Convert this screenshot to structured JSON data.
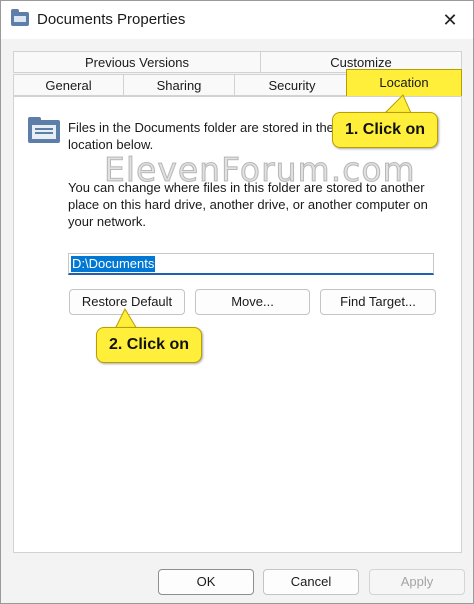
{
  "window": {
    "title": "Documents Properties",
    "close_glyph": "✕"
  },
  "tabs": {
    "row1": [
      {
        "label": "Previous Versions"
      },
      {
        "label": "Customize"
      }
    ],
    "row2": [
      {
        "label": "General"
      },
      {
        "label": "Sharing"
      },
      {
        "label": "Security"
      },
      {
        "label": "Location",
        "active": true
      }
    ]
  },
  "location": {
    "description_1": "Files in the Documents folder are stored in the target location below.",
    "description_2": "You can change where files in this folder are stored to another place on this hard drive, another drive, or another computer on your network.",
    "path_value": "D:\\Documents"
  },
  "buttons": {
    "restore_default": "Restore Default",
    "move": "Move...",
    "find_target": "Find Target...",
    "ok": "OK",
    "cancel": "Cancel",
    "apply": "Apply"
  },
  "annotations": {
    "callout_1": "1. Click on",
    "callout_2": "2. Click on",
    "watermark": "ElevenForum.com"
  },
  "colors": {
    "accent": "#0078d4",
    "callout": "#ffef3a"
  }
}
